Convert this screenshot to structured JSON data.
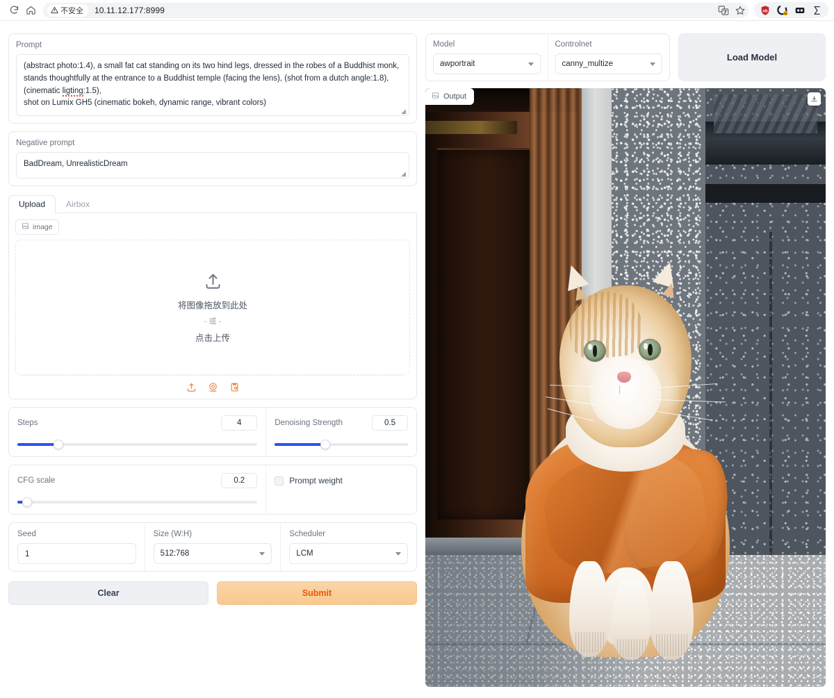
{
  "browser": {
    "reload_icon": "reload-icon",
    "home_icon": "home-icon",
    "security_warning": "不安全",
    "url": "10.11.12.177:8999",
    "translate_icon": "translate-icon",
    "bookmark_icon": "star-icon",
    "extensions": [
      "ublock-origin-icon",
      "grammarly-icon",
      "extension-dark-icon",
      "extension-sigma-icon"
    ]
  },
  "prompt": {
    "label": "Prompt",
    "value_line1": "(abstract photo:1.4), a small fat cat standing on its two hind legs, dressed in the robes of a Buddhist monk, stands thoughtfully at the entrance to a Buddhist temple (facing the lens), (shot from a dutch angle:1.8), (cinematic ",
    "misspelled_word": "ligting",
    "value_line1_tail": ":1.5),",
    "value_line2": "shot on Lumix GH5 (cinematic bokeh, dynamic range, vibrant colors)"
  },
  "negative_prompt": {
    "label": "Negative prompt",
    "value": "BadDream, UnrealisticDream"
  },
  "image_tabs": {
    "tabs": [
      {
        "label": "Upload",
        "active": true
      },
      {
        "label": "Airbox",
        "active": false
      }
    ],
    "chip_label": "image",
    "chip_icon": "image-icon",
    "dropzone": {
      "upload_icon": "upload-arrow-icon",
      "drag_text": "将图像拖放到此处",
      "or_text": "- 或 -",
      "click_text": "点击上传"
    },
    "tools": [
      "upload-icon",
      "webcam-icon",
      "paste-clipboard-icon"
    ]
  },
  "sliders": {
    "steps": {
      "label": "Steps",
      "value": "4",
      "percent": 17
    },
    "denoising": {
      "label": "Denoising Strength",
      "value": "0.5",
      "percent": 38
    },
    "cfg": {
      "label": "CFG scale",
      "value": "0.2",
      "percent": 4
    },
    "prompt_weight": {
      "label": "Prompt weight",
      "checked": false
    }
  },
  "settings": {
    "seed": {
      "label": "Seed",
      "value": "1"
    },
    "size": {
      "label": "Size (W:H)",
      "value": "512:768"
    },
    "scheduler": {
      "label": "Scheduler",
      "value": "LCM"
    }
  },
  "actions": {
    "clear_label": "Clear",
    "submit_label": "Submit"
  },
  "model_panel": {
    "model": {
      "label": "Model",
      "value": "awportrait"
    },
    "controlnet": {
      "label": "Controlnet",
      "value": "canny_multize"
    },
    "load_model_label": "Load Model"
  },
  "output": {
    "chip_label": "Output",
    "chip_icon": "image-icon",
    "download_icon": "download-icon",
    "description": "Generated photo of an orange and white cat wearing orange Buddhist monk robes, sitting at the entrance of a temple with wooden doors and granite pillars"
  },
  "colors": {
    "accent_blue": "#2b52f0",
    "submit_orange": "#e8590c",
    "submit_bg": "#f9c98e",
    "tool_orange": "#f0803c",
    "robe_orange": "#d9762c"
  }
}
